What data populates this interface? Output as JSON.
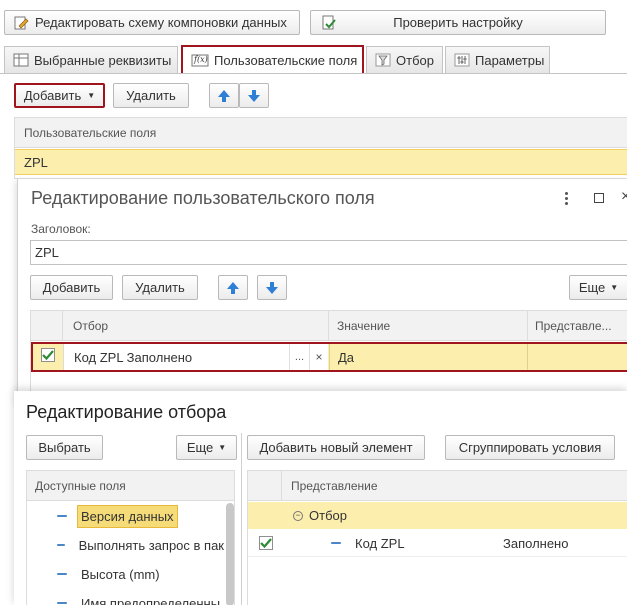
{
  "toolbar": {
    "edit_schema_label": "Редактировать схему компоновки данных",
    "check_settings_label": "Проверить настройку"
  },
  "tabs": [
    {
      "label": "Выбранные реквизиты"
    },
    {
      "label": "Пользовательские поля"
    },
    {
      "label": "Отбор"
    },
    {
      "label": "Параметры"
    }
  ],
  "actions": {
    "add_label": "Добавить",
    "delete_label": "Удалить"
  },
  "fields_table": {
    "header": "Пользовательские поля",
    "rows": [
      "ZPL"
    ]
  },
  "edit_field_dialog": {
    "title": "Редактирование пользовательского поля",
    "caption_label": "Заголовок:",
    "caption_value": "ZPL",
    "add_label": "Добавить",
    "delete_label": "Удалить",
    "more_label": "Еще",
    "columns": [
      "Отбор",
      "Значение",
      "Представле..."
    ],
    "row": {
      "filter": "Код ZPL Заполнено",
      "value": "Да",
      "presentation": "",
      "ellipsis": "...",
      "clear": "×"
    }
  },
  "edit_filter_dialog": {
    "title": "Редактирование отбора",
    "select_label": "Выбрать",
    "more_label": "Еще",
    "add_new_label": "Добавить новый элемент",
    "group_label": "Сгруппировать условия",
    "available_header": "Доступные поля",
    "available_fields": [
      "Версия данных",
      "Выполнять запрос в пак",
      "Высота (mm)",
      "Имя предопределенны"
    ],
    "repr_header": "Представление",
    "tree": {
      "group": "Отбор",
      "item_field": "Код ZPL",
      "item_condition": "Заполнено"
    }
  },
  "colors": {
    "accent_red": "#a0141e",
    "highlight_yellow": "#fbeba4",
    "selected_yellow": "#f6dc78",
    "arrow_blue": "#2e7fd6",
    "check_green": "#2f8a36"
  }
}
